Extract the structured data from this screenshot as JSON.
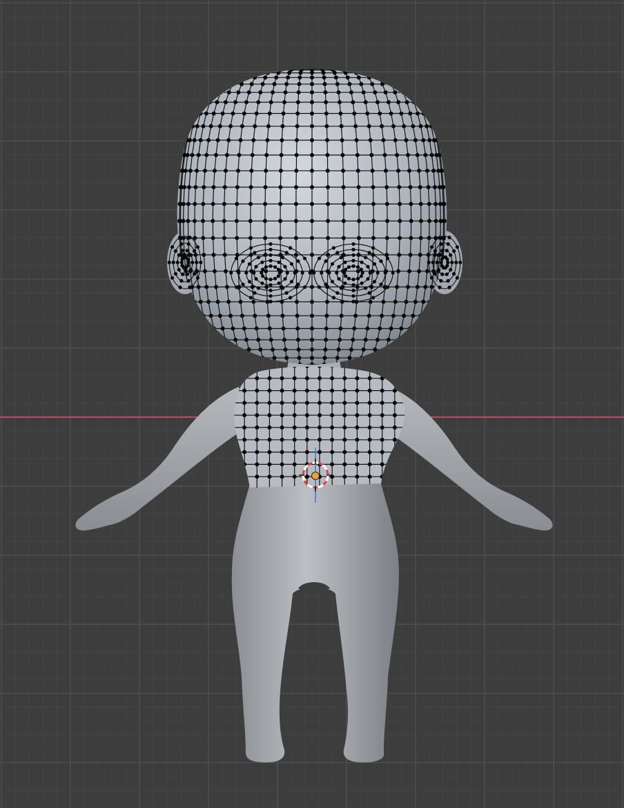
{
  "viewport": {
    "background": "#3d3d3d",
    "grid_minor_color": "#444444",
    "grid_major_color": "#4e4e4e",
    "x_axis_color": "#c74a5b",
    "z_axis_color": "#4a78c7",
    "mesh_color": "#b4b9bf",
    "wire_color": "#111111",
    "vertex_color": "#0a0a0a",
    "origin_color": "#f0a030",
    "cursor_colors": [
      "#ffffff",
      "#e04040"
    ]
  },
  "scene": {
    "object_icon": "chibi-character-mesh-icon",
    "mode": "edit-mode-wireframe-overlay",
    "cursor_icon": "3d-cursor-icon",
    "origin_icon": "object-origin-icon"
  }
}
